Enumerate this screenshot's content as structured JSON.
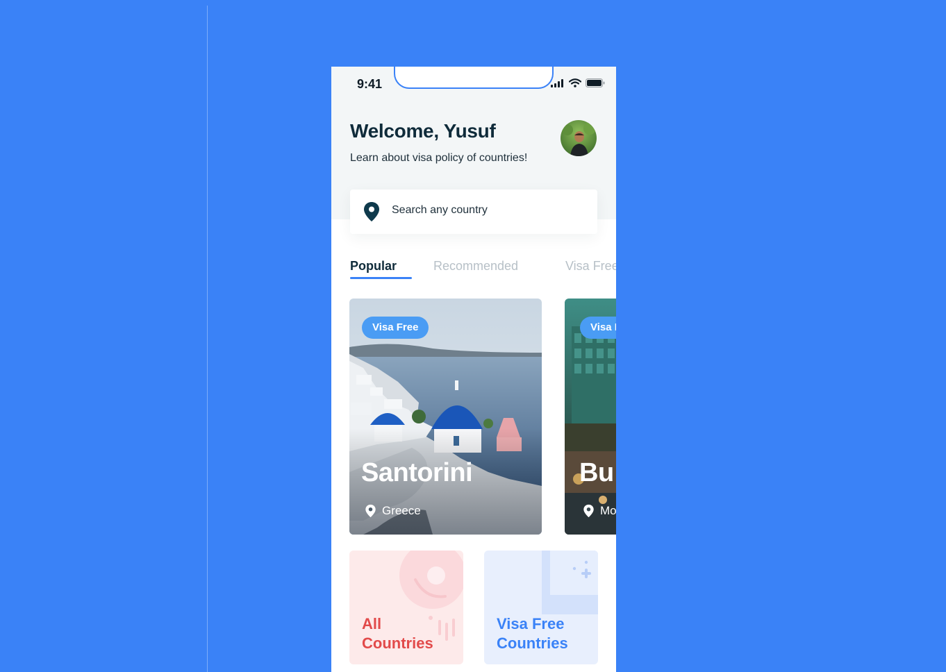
{
  "status_bar": {
    "time": "9:41"
  },
  "header": {
    "title": "Welcome, Yusuf",
    "subtitle": "Learn about visa policy of countries!"
  },
  "search": {
    "placeholder": "Search any country"
  },
  "tabs": [
    {
      "label": "Popular",
      "active": true
    },
    {
      "label": "Recommended",
      "active": false
    },
    {
      "label": "Visa Free",
      "active": false
    }
  ],
  "cards": [
    {
      "badge": "Visa Free",
      "title": "Santorini",
      "location": "Greece"
    },
    {
      "badge": "Visa F",
      "title": "Bu",
      "location": "Mo"
    }
  ],
  "categories": [
    {
      "label_line1": "All",
      "label_line2": "Countries",
      "color": "#e24a4a"
    },
    {
      "label_line1": "Visa Free",
      "label_line2": "Countries",
      "color": "#3a82f7"
    }
  ],
  "colors": {
    "accent": "#3a82f7",
    "badge": "#4a9cf4",
    "dark_text": "#0f2b3a"
  }
}
